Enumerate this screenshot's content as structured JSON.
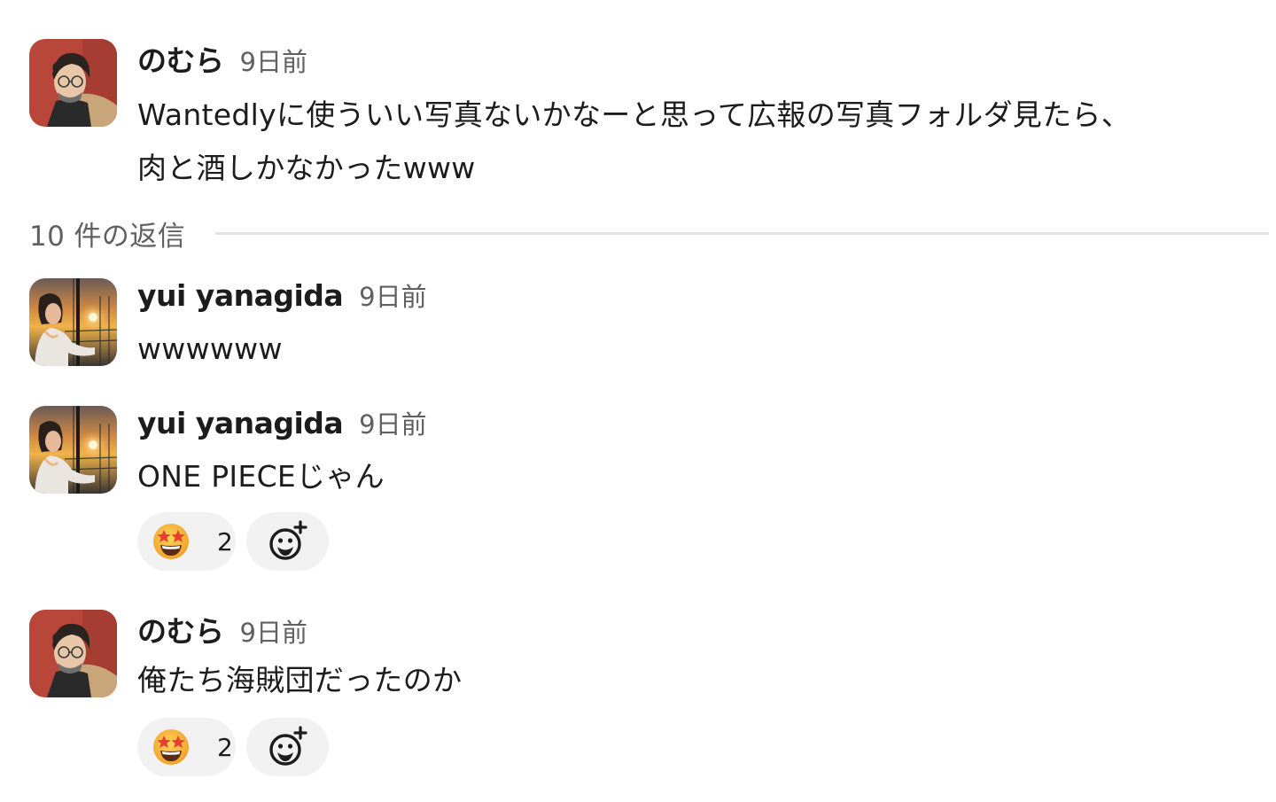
{
  "thread": {
    "parent": {
      "author": "のむら",
      "timestamp": "9日前",
      "text_line1": "Wantedlyに使ういい写真ないかなーと思って広報の写真フォルダ見たら、",
      "text_line2": "肉と酒しかなかったwww"
    },
    "reply_separator": {
      "label": "10 件の返信"
    },
    "replies": [
      {
        "author": "yui yanagida",
        "timestamp": "9日前",
        "text": "wwwwww"
      },
      {
        "author": "yui yanagida",
        "timestamp": "9日前",
        "text": "ONE PIECEじゃん",
        "reactions": [
          {
            "emoji": "star-struck-emoji",
            "count": "2"
          }
        ]
      },
      {
        "author": "のむら",
        "timestamp": "9日前",
        "text": "俺たち海賊団だったのか",
        "reactions": [
          {
            "emoji": "star-struck-emoji",
            "count": "2"
          }
        ]
      }
    ]
  },
  "icons": {
    "reaction": "star-struck-emoji",
    "add_reaction": "add-reaction-icon"
  },
  "colors": {
    "text": "#1d1c1d",
    "muted": "#616061",
    "pill_bg": "#f1f1f1",
    "separator": "#e3e3e4"
  }
}
